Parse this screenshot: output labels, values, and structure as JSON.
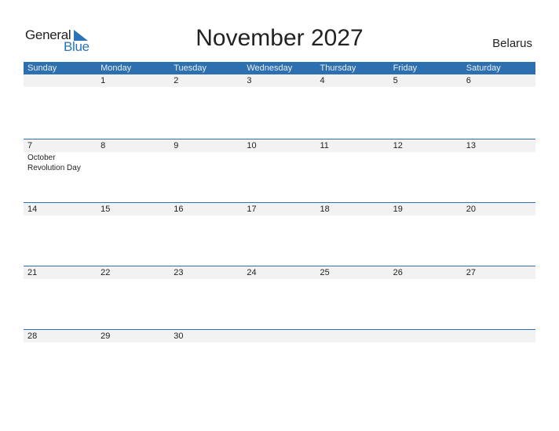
{
  "logo": {
    "line1": "General",
    "line2": "Blue"
  },
  "title": "November 2027",
  "country": "Belarus",
  "colors": {
    "header_bg": "#2e6fb0",
    "date_strip_bg": "#f2f2f2",
    "brand_blue": "#2a74b7"
  },
  "weekdays": [
    "Sunday",
    "Monday",
    "Tuesday",
    "Wednesday",
    "Thursday",
    "Friday",
    "Saturday"
  ],
  "weeks": [
    {
      "days": [
        {
          "date": "",
          "event": ""
        },
        {
          "date": "1",
          "event": ""
        },
        {
          "date": "2",
          "event": ""
        },
        {
          "date": "3",
          "event": ""
        },
        {
          "date": "4",
          "event": ""
        },
        {
          "date": "5",
          "event": ""
        },
        {
          "date": "6",
          "event": ""
        }
      ]
    },
    {
      "days": [
        {
          "date": "7",
          "event": "October Revolution Day"
        },
        {
          "date": "8",
          "event": ""
        },
        {
          "date": "9",
          "event": ""
        },
        {
          "date": "10",
          "event": ""
        },
        {
          "date": "11",
          "event": ""
        },
        {
          "date": "12",
          "event": ""
        },
        {
          "date": "13",
          "event": ""
        }
      ]
    },
    {
      "days": [
        {
          "date": "14",
          "event": ""
        },
        {
          "date": "15",
          "event": ""
        },
        {
          "date": "16",
          "event": ""
        },
        {
          "date": "17",
          "event": ""
        },
        {
          "date": "18",
          "event": ""
        },
        {
          "date": "19",
          "event": ""
        },
        {
          "date": "20",
          "event": ""
        }
      ]
    },
    {
      "days": [
        {
          "date": "21",
          "event": ""
        },
        {
          "date": "22",
          "event": ""
        },
        {
          "date": "23",
          "event": ""
        },
        {
          "date": "24",
          "event": ""
        },
        {
          "date": "25",
          "event": ""
        },
        {
          "date": "26",
          "event": ""
        },
        {
          "date": "27",
          "event": ""
        }
      ]
    },
    {
      "days": [
        {
          "date": "28",
          "event": ""
        },
        {
          "date": "29",
          "event": ""
        },
        {
          "date": "30",
          "event": ""
        },
        {
          "date": "",
          "event": ""
        },
        {
          "date": "",
          "event": ""
        },
        {
          "date": "",
          "event": ""
        },
        {
          "date": "",
          "event": ""
        }
      ]
    }
  ]
}
